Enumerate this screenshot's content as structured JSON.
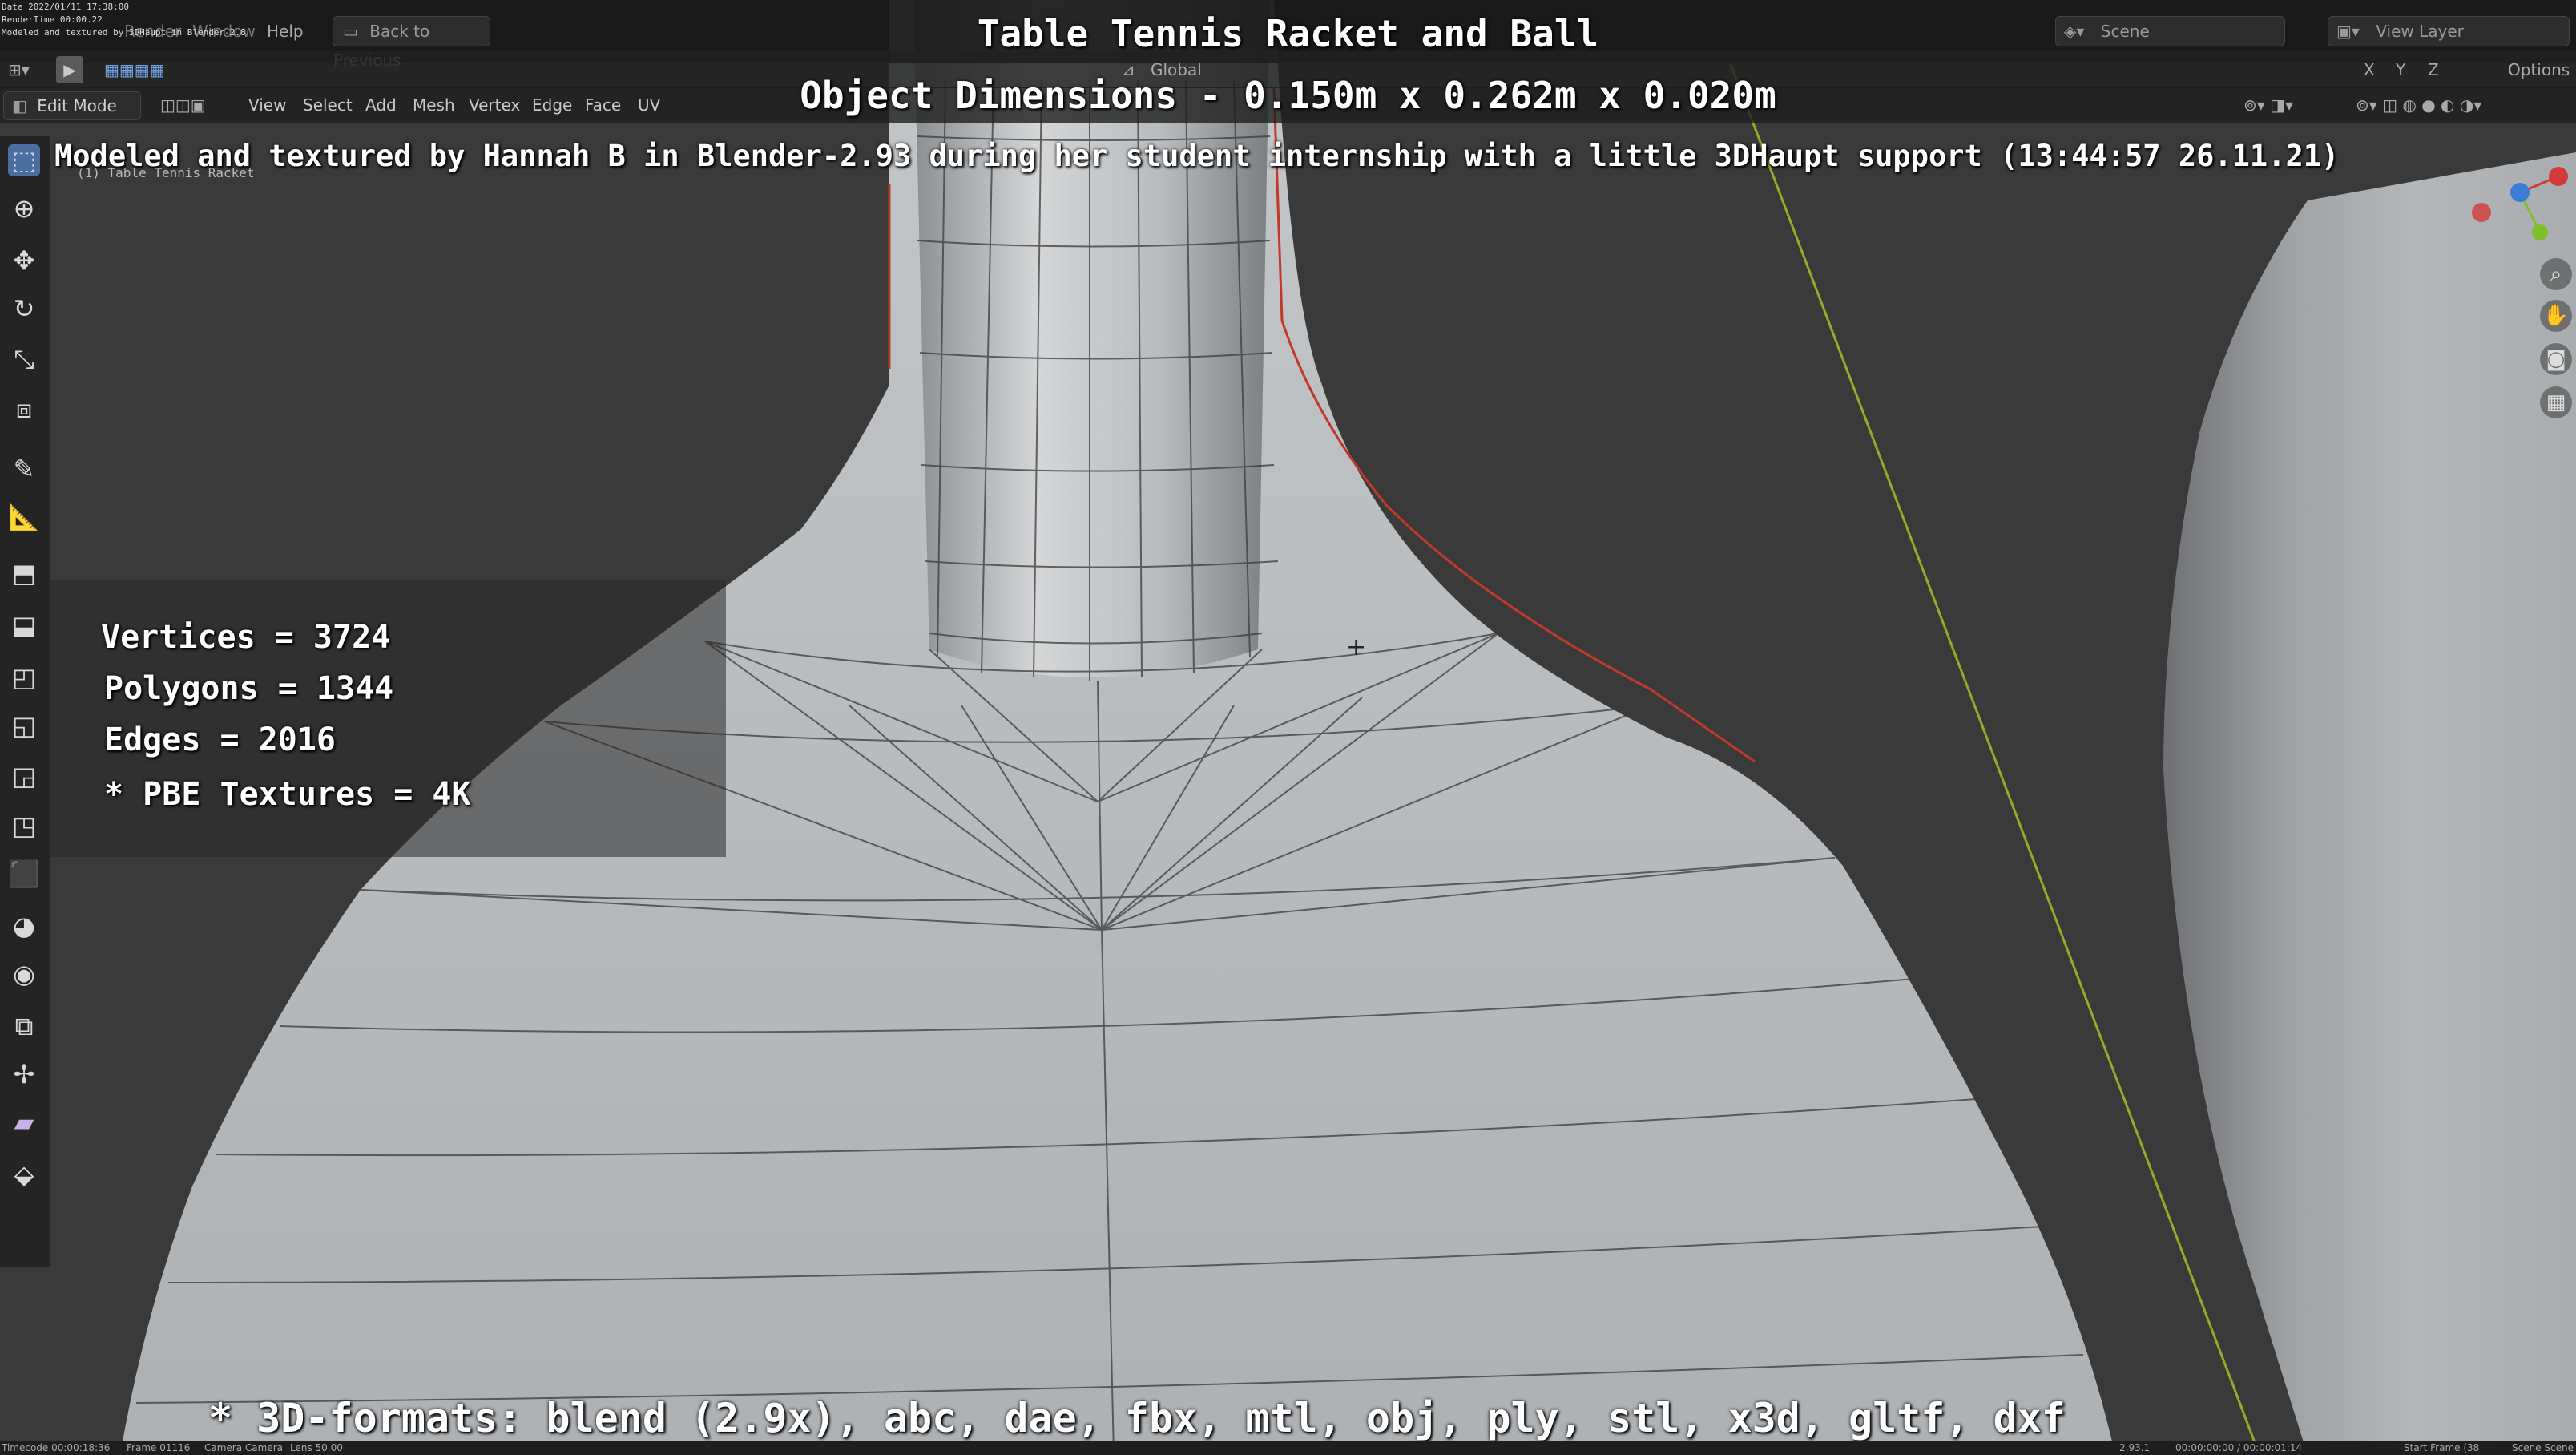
{
  "overlay": {
    "title": "Table Tennis Racket and Ball",
    "dimensions": "Object Dimensions -  0.150m x 0.262m x 0.020m",
    "credit": "Modeled and textured by Hannah B in Blender-2.93 during her student internship with a little 3DHaupt support (13:44:57 26.11.21)",
    "stats": {
      "vertices": "Vertices = 3724",
      "polygons": "Polygons = 1344",
      "edges": "Edges = 2016",
      "textures": "* PBE Textures = 4K"
    },
    "formats": "* 3D-formats: blend (2.9x), abc, dae, fbx, mtl, obj, ply, stl, x3d, gltf, dxf"
  },
  "stamp": {
    "date": "Date 2022/01/11 17:38:00",
    "rendertime": "RenderTime 00:00.22",
    "note": "Modeled and textured by 3DHaupt in Blender-2.8",
    "object": "(1) Table_Tennis_Racket"
  },
  "header": {
    "menus": [
      "Render",
      "Window",
      "Help"
    ],
    "back_button": "Back to Previous",
    "scene": "Scene",
    "view_layer": "View Layer",
    "options": "Options",
    "orientation": "Global",
    "axes": [
      "X",
      "Y",
      "Z"
    ]
  },
  "editor": {
    "mode": "Edit Mode",
    "menus": [
      "View",
      "Select",
      "Add",
      "Mesh",
      "Vertex",
      "Edge",
      "Face",
      "UV"
    ]
  },
  "statusbar": {
    "timecode": "Timecode 00:00:18:36",
    "frame": "Frame 01116",
    "camera": "Camera Camera",
    "lens": "Lens 50.00",
    "version": "2.93.1",
    "time": "00:00:00:00 / 00:00:01:14",
    "start": "Start Frame (38",
    "scene": "Scene Scene"
  },
  "colors": {
    "mesh_fill": "#b9bcbf",
    "mesh_wire": "#3a3a3a",
    "viewport_bg": "#3a3a3a",
    "edge_highlight": "#c0392b",
    "axis_line": "#8fae2a",
    "gizmo_x": "#d33b3b",
    "gizmo_y": "#7fbf2a",
    "gizmo_z": "#3b7bd3"
  },
  "icons": {
    "left_toolbar": [
      "select-box-icon",
      "cursor-icon",
      "move-icon",
      "rotate-icon",
      "scale-icon",
      "transform-icon",
      "annotate-icon",
      "measure-icon",
      "add-cube-icon",
      "extrude-icon",
      "inset-icon",
      "bevel-icon",
      "loop-cut-icon",
      "knife-icon",
      "poly-build-icon",
      "spin-icon",
      "smooth-icon",
      "edge-slide-icon",
      "shrink-fatten-icon",
      "shear-icon",
      "rip-icon"
    ],
    "right_nav": [
      "zoom-icon",
      "pan-hand-icon",
      "camera-view-icon",
      "grid-ortho-icon"
    ]
  }
}
